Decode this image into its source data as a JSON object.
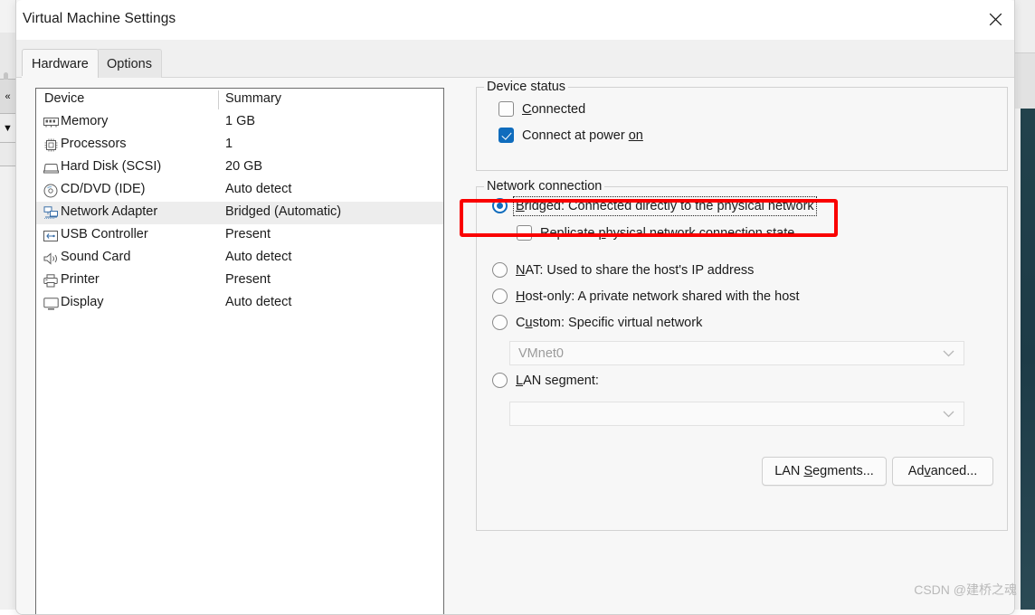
{
  "window": {
    "title": "Virtual Machine Settings",
    "close_icon": "close-icon"
  },
  "tabs": [
    {
      "label": "Hardware",
      "active": true
    },
    {
      "label": "Options",
      "active": false
    }
  ],
  "device_table": {
    "columns": [
      "Device",
      "Summary"
    ],
    "rows": [
      {
        "icon": "memory-icon",
        "name": "Memory",
        "summary": "1 GB",
        "selected": false
      },
      {
        "icon": "processor-icon",
        "name": "Processors",
        "summary": "1",
        "selected": false
      },
      {
        "icon": "hard-disk-icon",
        "name": "Hard Disk (SCSI)",
        "summary": "20 GB",
        "selected": false
      },
      {
        "icon": "cd-dvd-icon",
        "name": "CD/DVD (IDE)",
        "summary": "Auto detect",
        "selected": false
      },
      {
        "icon": "network-icon",
        "name": "Network Adapter",
        "summary": "Bridged (Automatic)",
        "selected": true
      },
      {
        "icon": "usb-icon",
        "name": "USB Controller",
        "summary": "Present",
        "selected": false
      },
      {
        "icon": "sound-card-icon",
        "name": "Sound Card",
        "summary": "Auto detect",
        "selected": false
      },
      {
        "icon": "printer-icon",
        "name": "Printer",
        "summary": "Present",
        "selected": false
      },
      {
        "icon": "display-icon",
        "name": "Display",
        "summary": "Auto detect",
        "selected": false
      }
    ]
  },
  "device_status": {
    "title": "Device status",
    "connected": {
      "label": "Connected",
      "mnemonic": "C",
      "checked": false
    },
    "connect_at_power_on": {
      "label": "Connect at power on",
      "mnemonic": "on",
      "checked": true
    }
  },
  "network_connection": {
    "title": "Network connection",
    "options": [
      {
        "label": "Bridged: Connected directly to the physical network",
        "mnemonic": "B",
        "selected": true,
        "focused": true
      },
      {
        "label": "NAT: Used to share the host's IP address",
        "mnemonic": "N",
        "selected": false,
        "focused": false
      },
      {
        "label": "Host-only: A private network shared with the host",
        "mnemonic": "H",
        "selected": false,
        "focused": false
      },
      {
        "label": "Custom: Specific virtual network",
        "mnemonic": "u",
        "selected": false,
        "focused": false
      },
      {
        "label": "LAN segment:",
        "mnemonic": "L",
        "selected": false,
        "focused": false
      }
    ],
    "replicate_checkbox": {
      "label": "Replicate physical network connection state",
      "mnemonic": "p",
      "checked": false
    },
    "custom_combo": {
      "value": "VMnet0",
      "disabled": true
    },
    "lan_segment_combo": {
      "value": "",
      "disabled": true
    }
  },
  "buttons": {
    "lan_segments": "LAN Segments...",
    "advanced": "Advanced..."
  },
  "annotation": {
    "highlight_color": "#fa0000",
    "highlights": "bridged-option"
  },
  "watermark": "CSDN @建桥之魂",
  "colors": {
    "accent": "#0f6cbd",
    "dialog_bg": "#f7f7f7",
    "list_bg": "#ffffff",
    "row_selected": "#ededed",
    "border": "#d2d2d2",
    "text": "#1b1b1b",
    "disabled_text": "#9b9b9b"
  }
}
